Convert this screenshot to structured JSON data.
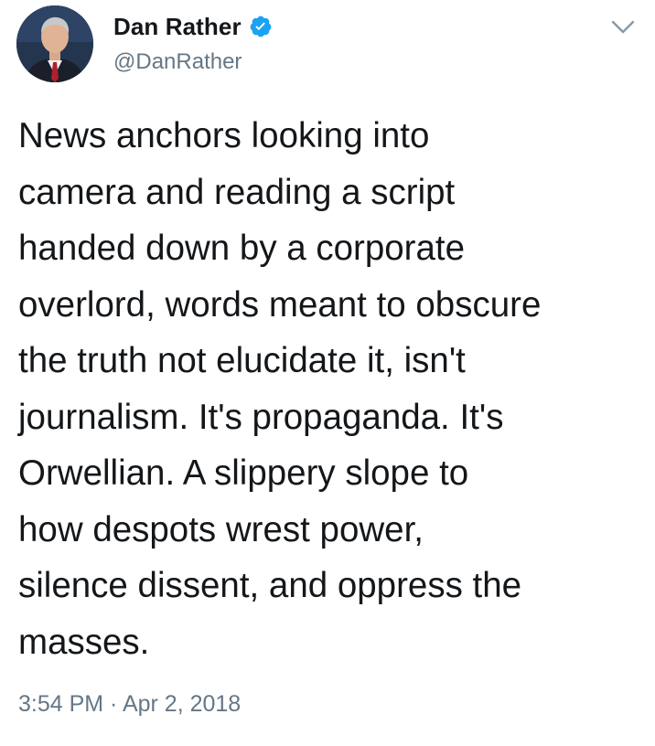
{
  "tweet": {
    "author": {
      "display_name": "Dan Rather",
      "handle": "@DanRather",
      "verified": true,
      "avatar_icon": "avatar-photo"
    },
    "menu_icon": "chevron-down-icon",
    "text_lines": [
      "News anchors looking into",
      "camera and reading a script",
      "handed down by a corporate",
      "overlord, words meant to obscure",
      "the truth not elucidate it, isn't",
      "journalism. It's propaganda. It's",
      "Orwellian. A slippery slope to",
      "how despots wrest power,",
      "silence dissent, and oppress the",
      "masses."
    ],
    "timestamp": "3:54 PM · Apr 2, 2018"
  },
  "colors": {
    "primary_text": "#14171a",
    "secondary_text": "#657786",
    "verified_blue": "#1da1f2",
    "background": "#ffffff"
  }
}
